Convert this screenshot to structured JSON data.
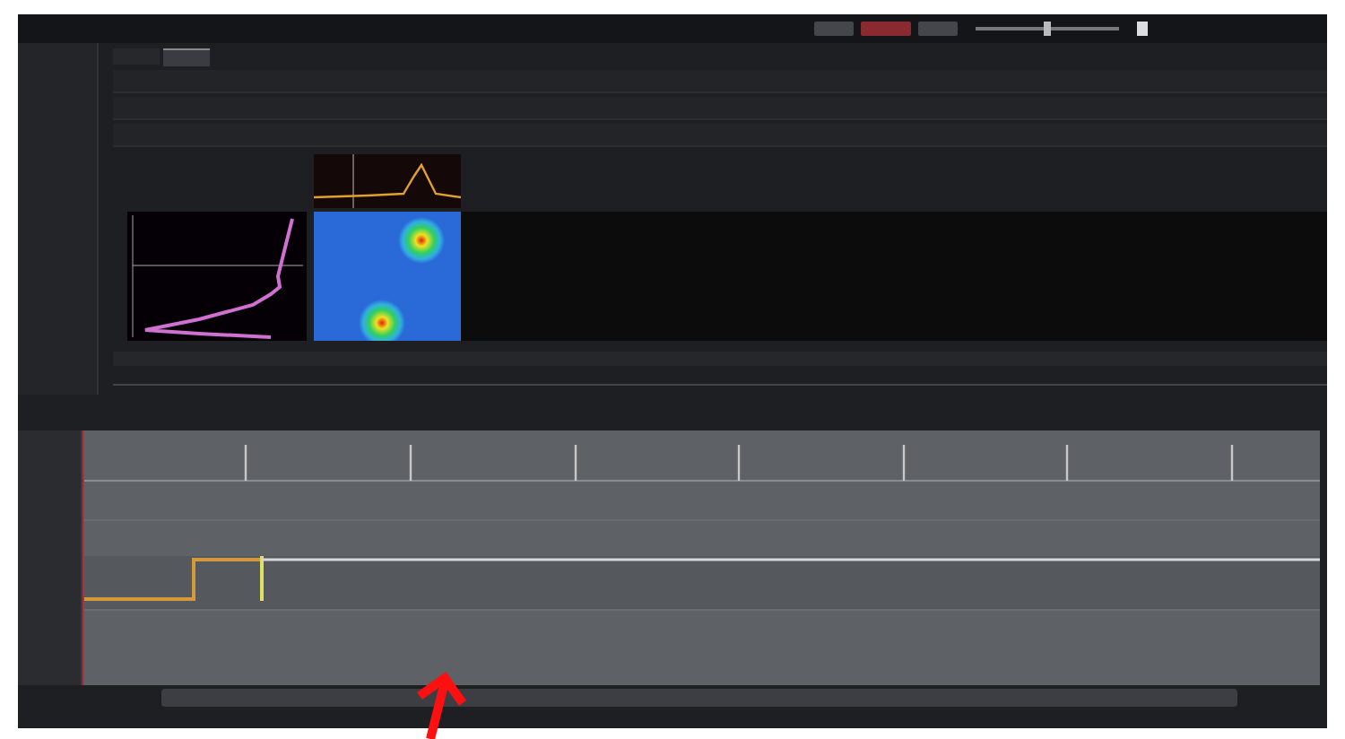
{
  "tabs": [
    {
      "selected": false
    },
    {
      "selected": true
    }
  ],
  "slider": {
    "level": 0.5
  }
}
